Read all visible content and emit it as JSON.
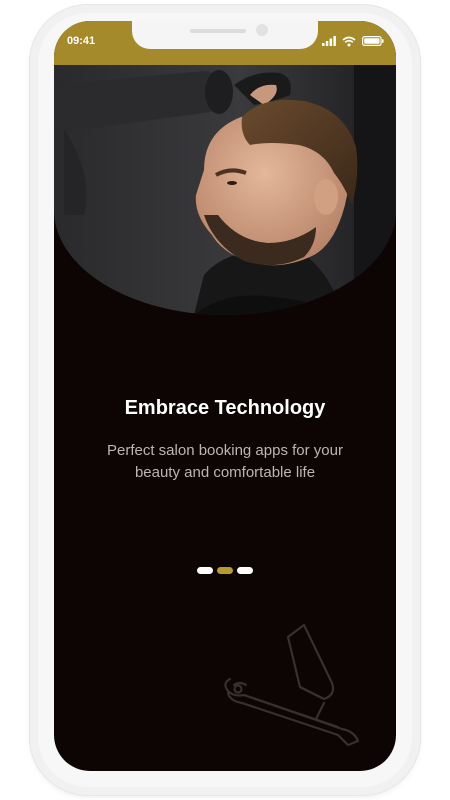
{
  "status_bar": {
    "time": "09:41",
    "icons": [
      "signal-icon",
      "wifi-icon",
      "battery-icon"
    ],
    "color": "#a58a2c"
  },
  "hero": {
    "image": "man-barber-haircut-photo"
  },
  "onboarding": {
    "title": "Embrace Technology",
    "subtitle": "Perfect salon booking apps for your beauty and comfortable life",
    "pages": [
      {
        "active": false
      },
      {
        "active": true
      },
      {
        "active": false
      }
    ]
  },
  "decor": {
    "icon": "straight-razor-icon"
  },
  "colors": {
    "background": "#0d0404",
    "accent": "#b89a35",
    "title": "#ffffff",
    "subtitle": "#bdb5b5"
  }
}
